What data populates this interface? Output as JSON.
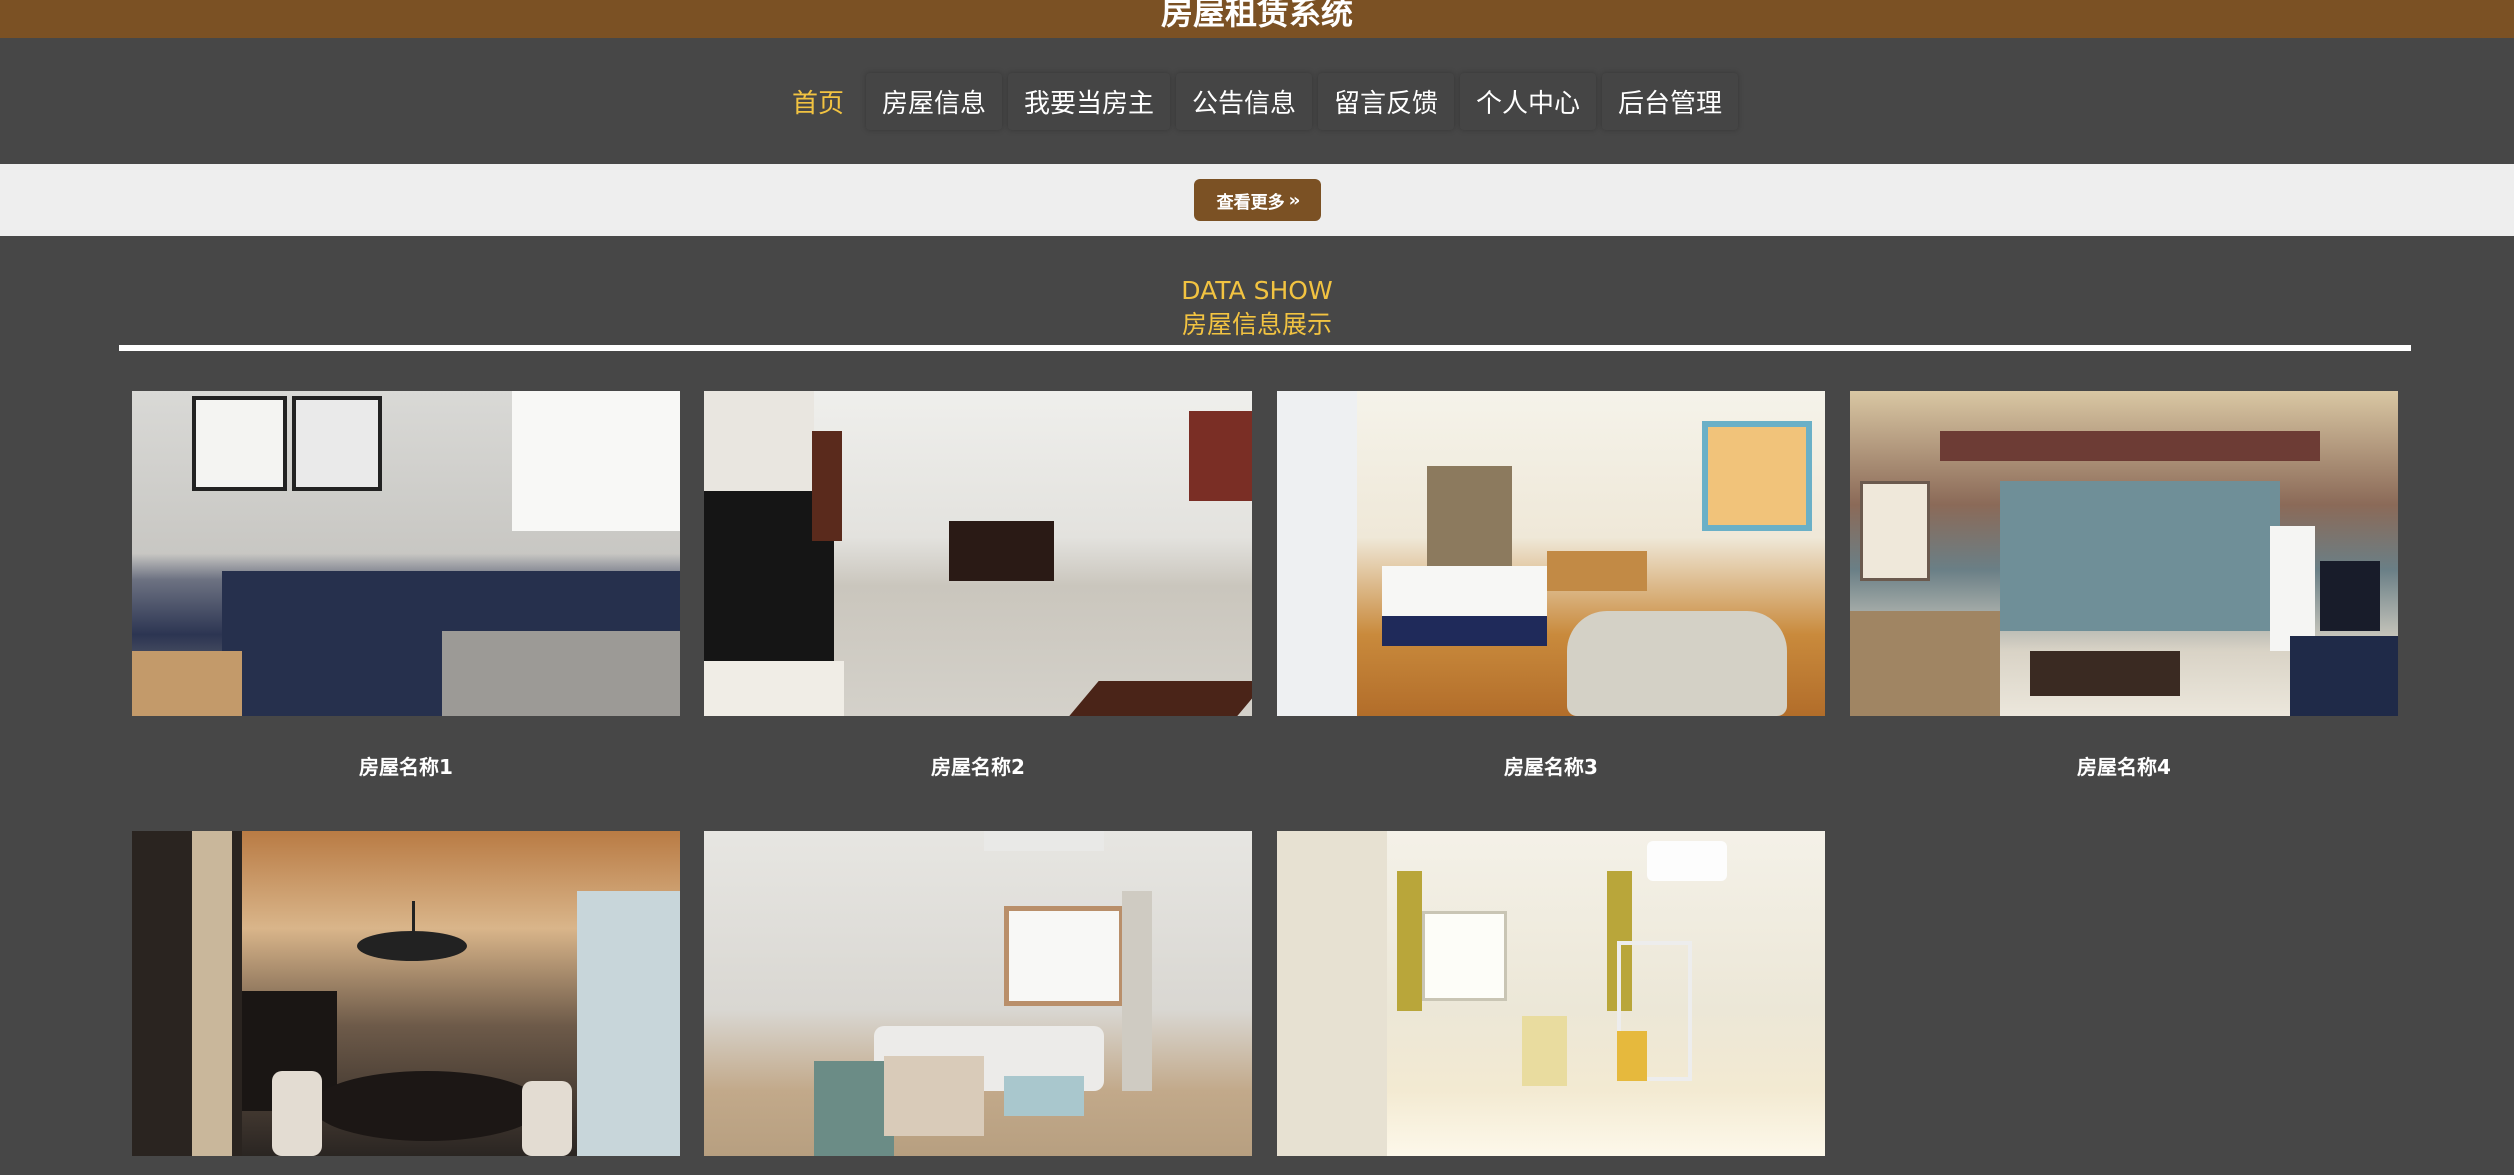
{
  "header": {
    "title": "房屋租赁系统"
  },
  "nav": {
    "items": [
      {
        "label": "首页",
        "active": true
      },
      {
        "label": "房屋信息",
        "active": false
      },
      {
        "label": "我要当房主",
        "active": false
      },
      {
        "label": "公告信息",
        "active": false
      },
      {
        "label": "留言反馈",
        "active": false
      },
      {
        "label": "个人中心",
        "active": false
      },
      {
        "label": "后台管理",
        "active": false
      }
    ]
  },
  "more": {
    "label": "查看更多",
    "icon": "double-chevron-right-icon"
  },
  "section": {
    "title_en": "DATA SHOW",
    "title_cn": "房屋信息展示"
  },
  "houses": [
    {
      "name": "房屋名称1",
      "photo": "bedroom"
    },
    {
      "name": "房屋名称2",
      "photo": "dining-room"
    },
    {
      "name": "房屋名称3",
      "photo": "hotel-room"
    },
    {
      "name": "房屋名称4",
      "photo": "living-room"
    },
    {
      "name": "",
      "photo": "dining-chandelier"
    },
    {
      "name": "",
      "photo": "living-sofa"
    },
    {
      "name": "",
      "photo": "study-room"
    }
  ],
  "colors": {
    "brand": "#7b5124",
    "accent": "#f2c341",
    "background": "#474747",
    "more_bar": "#eeeeee"
  }
}
